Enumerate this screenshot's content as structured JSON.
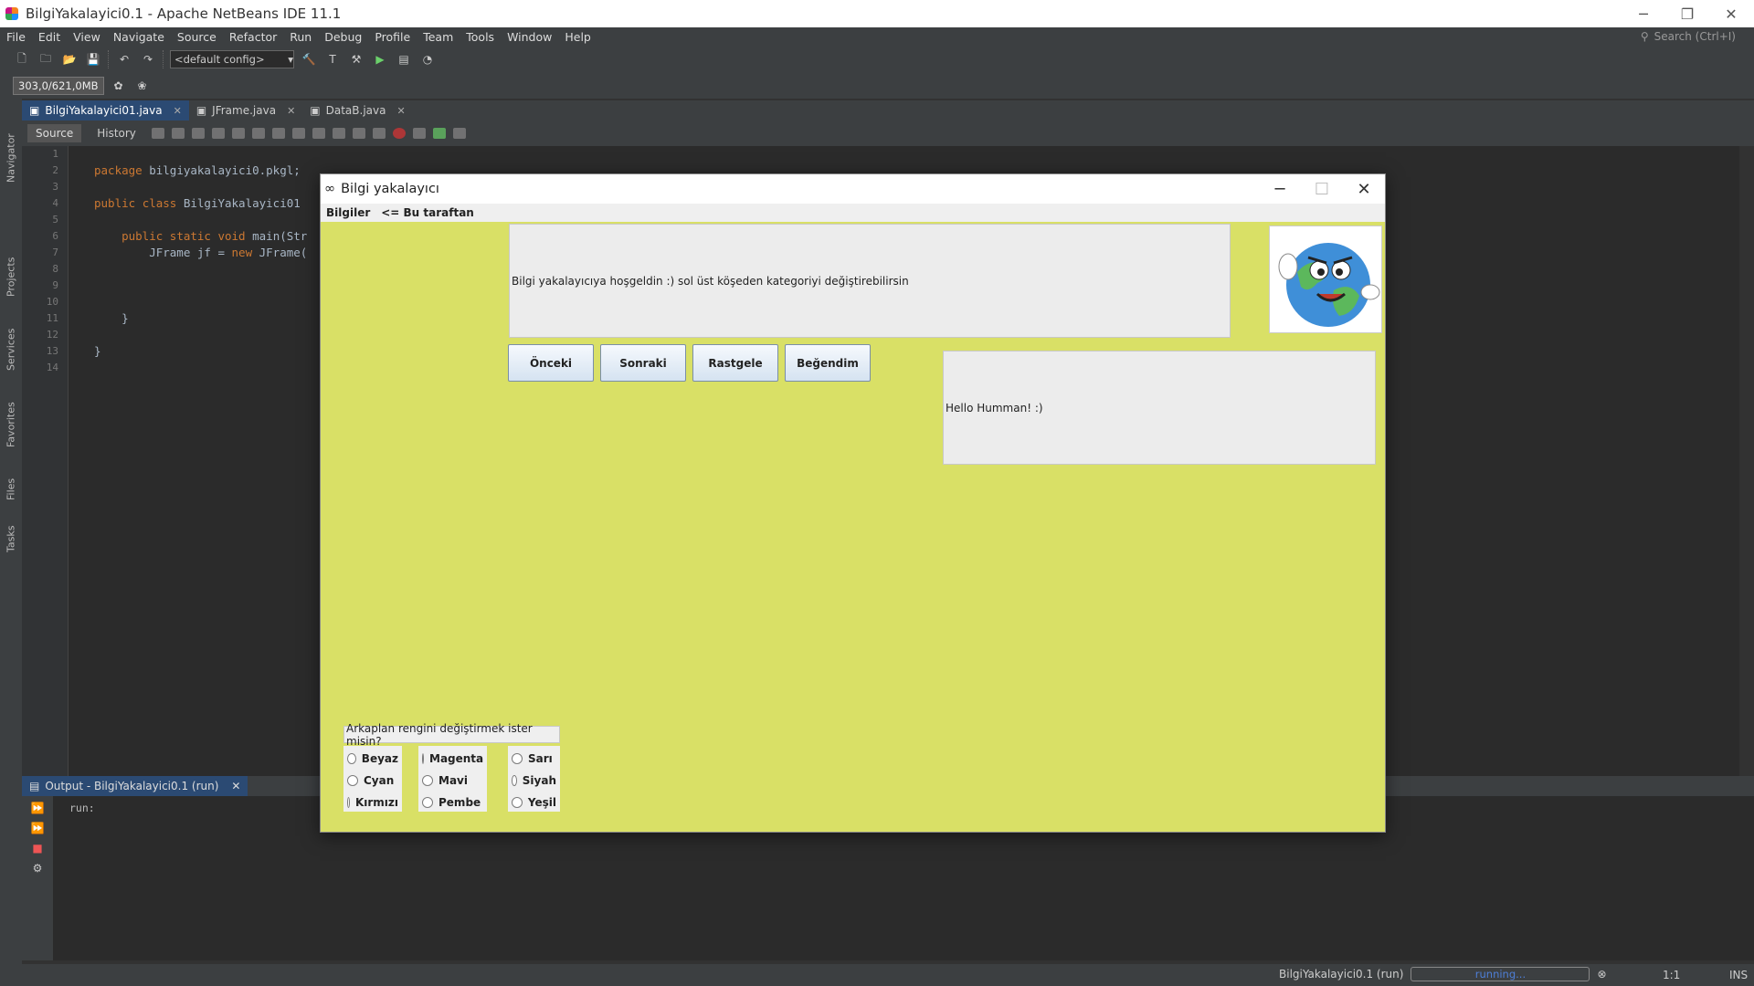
{
  "ide": {
    "title": "BilgiYakalayici0.1 - Apache NetBeans IDE 11.1",
    "menu": [
      "File",
      "Edit",
      "View",
      "Navigate",
      "Source",
      "Refactor",
      "Run",
      "Debug",
      "Profile",
      "Team",
      "Tools",
      "Window",
      "Help"
    ],
    "search_placeholder": "Search (Ctrl+I)",
    "config": "<default config>",
    "memory": "303,0/621,0MB",
    "side_tabs": [
      "Navigator",
      "Projects",
      "Services",
      "Favorites",
      "Files",
      "Tasks"
    ],
    "editor_tabs": [
      {
        "label": "BilgiYakalayici01.java",
        "active": true
      },
      {
        "label": "JFrame.java",
        "active": false
      },
      {
        "label": "DataB.java",
        "active": false
      }
    ],
    "source_label": "Source",
    "history_label": "History",
    "line_numbers": [
      "1",
      "2",
      "3",
      "4",
      "5",
      "6",
      "7",
      "8",
      "9",
      "10",
      "11",
      "12",
      "13",
      "14"
    ],
    "code_lines": [
      "",
      "package bilgiyakalayici0.pkgl;",
      "",
      "public class BilgiYakalayici01",
      "",
      "    public static void main(Str",
      "        JFrame jf = new JFrame(",
      "",
      "",
      "",
      "    }",
      "",
      "}",
      ""
    ],
    "output_tab": "Output - BilgiYakalayici0.1 (run)",
    "output_text": "run:",
    "status_project": "BilgiYakalayici0.1 (run)",
    "status_progress": "running...",
    "status_position": "1:1",
    "status_mode": "INS"
  },
  "app": {
    "title": "Bilgi yakalayıcı",
    "menu": [
      "Bilgiler",
      "<= Bu taraftan"
    ],
    "info_text": "Bilgi yakalayıcıya hoşgeldin :) sol üst köşeden kategoriyi değiştirebilirsin",
    "picture_icon": "earth-cartoon-icon",
    "buttons": [
      "Önceki",
      "Sonraki",
      "Rastgele",
      "Beğendim"
    ],
    "hello_text": "Hello Humman! :)",
    "color_question": "Arkaplan rengini değiştirmek ister misin?",
    "radio_groups": [
      [
        "Beyaz",
        "Cyan",
        "Kırmızı"
      ],
      [
        "Magenta",
        "Mavi",
        "Pembe"
      ],
      [
        "Sarı",
        "Siyah",
        "Yeşil"
      ]
    ],
    "background_color": "#d9e066"
  }
}
